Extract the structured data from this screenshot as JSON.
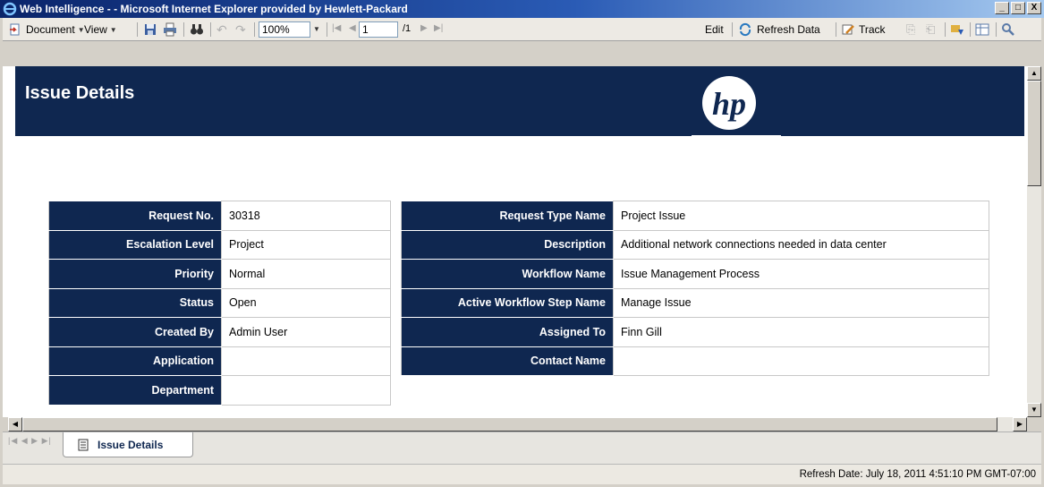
{
  "window": {
    "title": "Web Intelligence - - Microsoft Internet Explorer provided by Hewlett-Packard",
    "buttons": [
      "_",
      "□",
      "X"
    ]
  },
  "toolbar": {
    "document_label": "Document",
    "view_label": "View",
    "zoom_value": "100%",
    "page_value": "1",
    "page_total": "/1",
    "edit_label": "Edit",
    "refresh_label": "Refresh Data",
    "track_label": "Track"
  },
  "report": {
    "title": "Issue Details",
    "logo_text": "hp",
    "left_table": [
      {
        "label": "Request No.",
        "value": "30318"
      },
      {
        "label": "Escalation Level",
        "value": "Project"
      },
      {
        "label": "Priority",
        "value": "Normal"
      },
      {
        "label": "Status",
        "value": "Open"
      },
      {
        "label": "Created By",
        "value": "Admin User"
      },
      {
        "label": "Application",
        "value": ""
      },
      {
        "label": "Department",
        "value": ""
      }
    ],
    "right_table": [
      {
        "label": "Request Type Name",
        "value": "Project Issue"
      },
      {
        "label": "Description",
        "value": "Additional network connections needed in data center"
      },
      {
        "label": "Workflow Name",
        "value": "Issue Management Process"
      },
      {
        "label": "Active Workflow Step Name",
        "value": "Manage Issue"
      },
      {
        "label": "Assigned To",
        "value": "Finn Gill"
      },
      {
        "label": "Contact Name",
        "value": ""
      }
    ]
  },
  "tabs": [
    {
      "label": "Issue Details",
      "active": true
    }
  ],
  "status": {
    "refresh_date": "Refresh Date: July 18, 2011 4:51:10 PM GMT-07:00"
  },
  "colors": {
    "header_navy": "#0f2750",
    "title_bar": "#0a246a"
  }
}
